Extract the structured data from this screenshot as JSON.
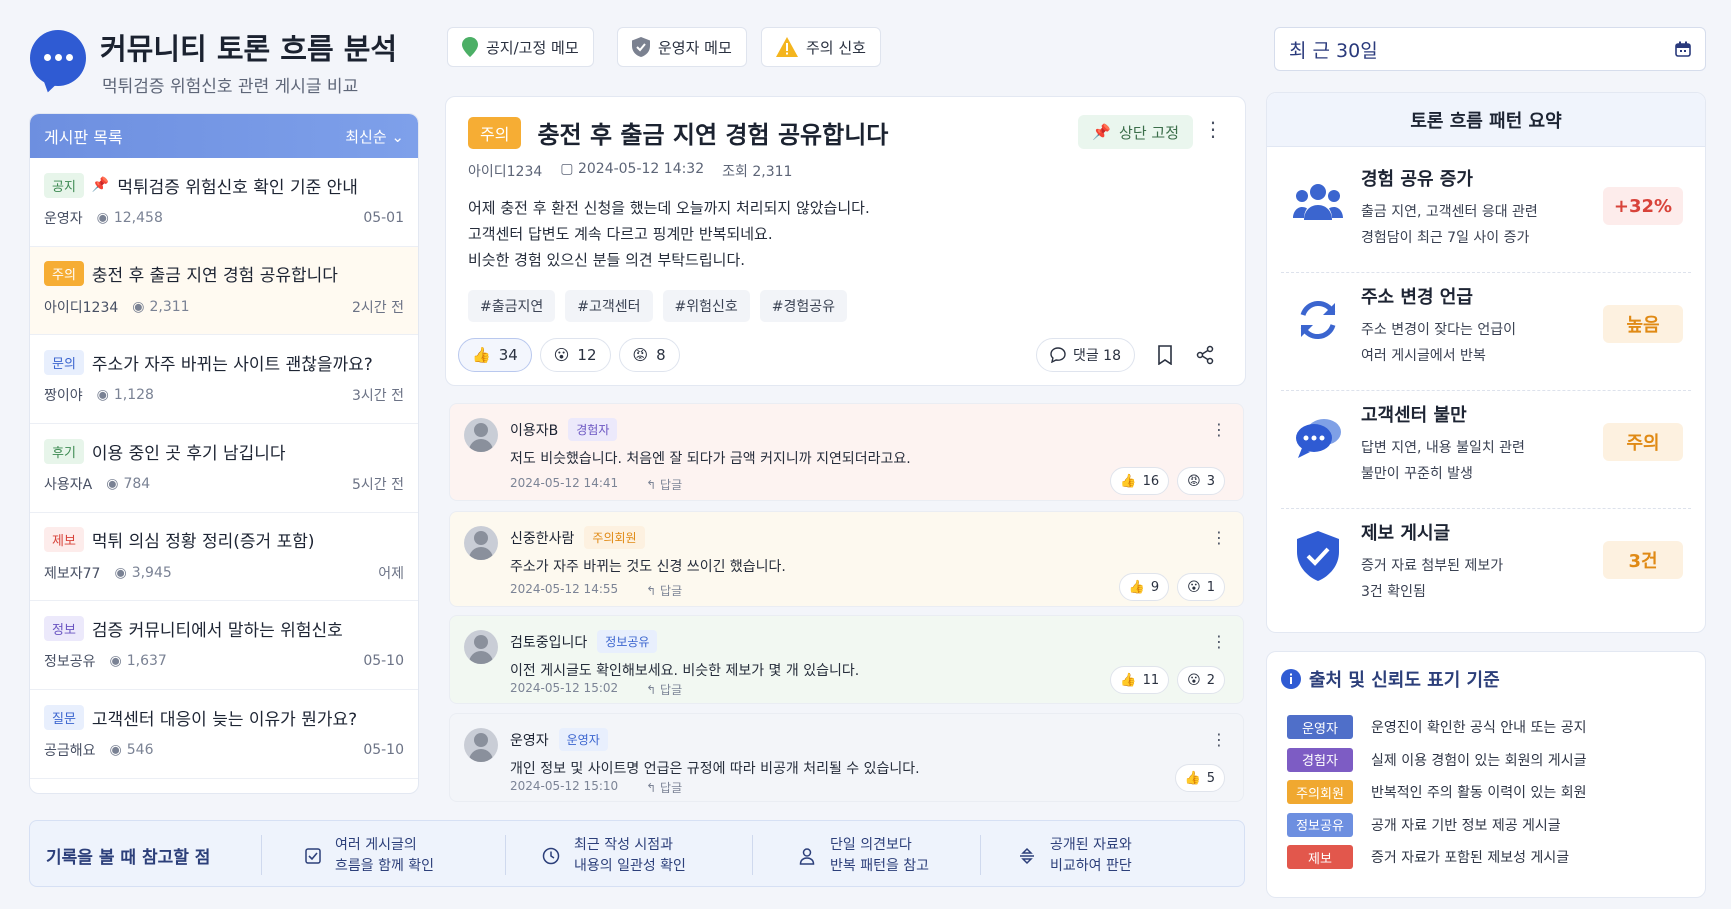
{
  "header": {
    "title": "커뮤니티 토론 흐름 분석",
    "subtitle": "먹튀검증 위험신호 관련 게시글 비교"
  },
  "toolbar": {
    "notice_label": "공지/고정 메모",
    "admin_label": "운영자 메모",
    "warning_label": "주의 신호"
  },
  "date_filter": {
    "label": "최 근 30일"
  },
  "board": {
    "title": "게시판 목록",
    "sort": "최신순",
    "items": [
      {
        "tag": "공지",
        "pinned": true,
        "title": "먹튀검증 위험신호 확인 기준 안내",
        "author": "운영자",
        "views": "12,458",
        "time": "05-01"
      },
      {
        "tag": "주의",
        "title": "충전 후 출금 지연 경험 공유합니다",
        "author": "아이디1234",
        "views": "2,311",
        "time": "2시간 전"
      },
      {
        "tag": "문의",
        "title": "주소가 자주 바뀌는 사이트 괜찮을까요?",
        "author": "짱이야",
        "views": "1,128",
        "time": "3시간 전"
      },
      {
        "tag": "후기",
        "title": "이용 중인 곳 후기 남깁니다",
        "author": "사용자A",
        "views": "784",
        "time": "5시간 전"
      },
      {
        "tag": "제보",
        "title": "먹튀 의심 정황 정리(증거 포함)",
        "author": "제보자77",
        "views": "3,945",
        "time": "어제"
      },
      {
        "tag": "정보",
        "title": "검증 커뮤니티에서 말하는 위험신호",
        "author": "정보공유",
        "views": "1,637",
        "time": "05-10"
      },
      {
        "tag": "질문",
        "title": "고객센터 대응이 늦는 이유가 뭔가요?",
        "author": "공금해요",
        "views": "546",
        "time": "05-10"
      }
    ]
  },
  "post": {
    "tag": "주의",
    "title": "충전 후 출금 지연 경험 공유합니다",
    "pin_label": "상단 고정",
    "author": "아이디1234",
    "date": "2024-05-12 14:32",
    "views": "조회 2,311",
    "body": [
      "어제 충전 후 환전 신청을 했는데 오늘까지 처리되지 않았습니다.",
      "고객센터 답변도 계속 다르고 핑계만 반복되네요.",
      "비슷한 경험 있으신 분들 의견 부탁드립니다."
    ],
    "tags": [
      "#출금지연",
      "#고객센터",
      "#위험신호",
      "#경험공유"
    ],
    "reactions": {
      "like": "34",
      "wow": "12",
      "angry": "8"
    },
    "comments_label": "댓글 18"
  },
  "comments": [
    {
      "name": "이용자B",
      "badge": "경험자",
      "text": "저도 비슷했습니다. 처음엔 잘 되다가 금액 커지니까 지연되더라고요.",
      "date": "2024-05-12 14:41",
      "reply": "답글",
      "like": "16",
      "other": "3",
      "other_icon": "angry-icon"
    },
    {
      "name": "신중한사람",
      "badge": "주의회원",
      "text": "주소가 자주 바뀌는 것도 신경 쓰이긴 했습니다.",
      "date": "2024-05-12 14:55",
      "reply": "답글",
      "like": "9",
      "other": "1",
      "other_icon": "wow-icon"
    },
    {
      "name": "검토중입니다",
      "badge": "정보공유",
      "text": "이전 게시글도 확인해보세요. 비슷한 제보가 몇 개 있습니다.",
      "date": "2024-05-12 15:02",
      "reply": "답글",
      "like": "11",
      "other": "2",
      "other_icon": "wow-icon"
    },
    {
      "name": "운영자",
      "badge": "운영자",
      "text": "개인 정보 및 사이트명 언급은 규정에 따라 비공개 처리될 수 있습니다.",
      "date": "2024-05-12 15:10",
      "reply": "답글",
      "like": "5"
    }
  ],
  "tips": {
    "title": "기록을 볼 때 참고할 점",
    "items": [
      {
        "line1": "여러 게시글의",
        "line2": "흐름을 함께 확인",
        "icon": "check-square-icon"
      },
      {
        "line1": "최근 작성 시점과",
        "line2": "내용의 일관성 확인",
        "icon": "clock-icon"
      },
      {
        "line1": "단일 의견보다",
        "line2": "반복 패턴을 참고",
        "icon": "user-icon"
      },
      {
        "line1": "공개된 자료와",
        "line2": "비교하여 판단",
        "icon": "compare-icon"
      }
    ]
  },
  "summary": {
    "title": "토론 흐름 패턴 요약",
    "items": [
      {
        "title": "경험 공유 증가",
        "desc1": "출금 지연, 고객센터 응대 관련",
        "desc2": "경험담이 최근 7일 사이 증가",
        "badge": "+32%",
        "icon": "users-icon"
      },
      {
        "title": "주소 변경 언급",
        "desc1": "주소 변경이 잦다는 언급이",
        "desc2": "여러 게시글에서 반복",
        "badge": "높음",
        "icon": "refresh-icon"
      },
      {
        "title": "고객센터 불만",
        "desc1": "답변 지연, 내용 불일치 관련",
        "desc2": "불만이 꾸준히 발생",
        "badge": "주의",
        "icon": "chat-bubbles-icon"
      },
      {
        "title": "제보 게시글",
        "desc1": "증거 자료 첨부된 제보가",
        "desc2": "3건 확인됨",
        "badge": "3건",
        "icon": "shield-check-icon"
      }
    ]
  },
  "legend": {
    "title": "출처 및 신뢰도 표기 기준",
    "items": [
      {
        "tag": "운영자",
        "desc": "운영진이 확인한 공식 안내 또는 공지",
        "color": "#4f6fc9"
      },
      {
        "tag": "경험자",
        "desc": "실제 이용 경험이 있는 회원의 게시글",
        "color": "#7d5cc4"
      },
      {
        "tag": "주의회원",
        "desc": "반복적인 주의 활동 이력이 있는 회원",
        "color": "#f0a830"
      },
      {
        "tag": "정보공유",
        "desc": "공개 자료 기반 정보 제공 게시글",
        "color": "#6d8fe0"
      },
      {
        "tag": "제보",
        "desc": "증거 자료가 포함된 제보성 게시글",
        "color": "#e2574c"
      }
    ]
  },
  "colors": {
    "accent": "#2f5bd3",
    "warning": "#f0a830",
    "danger": "#e2574c"
  }
}
